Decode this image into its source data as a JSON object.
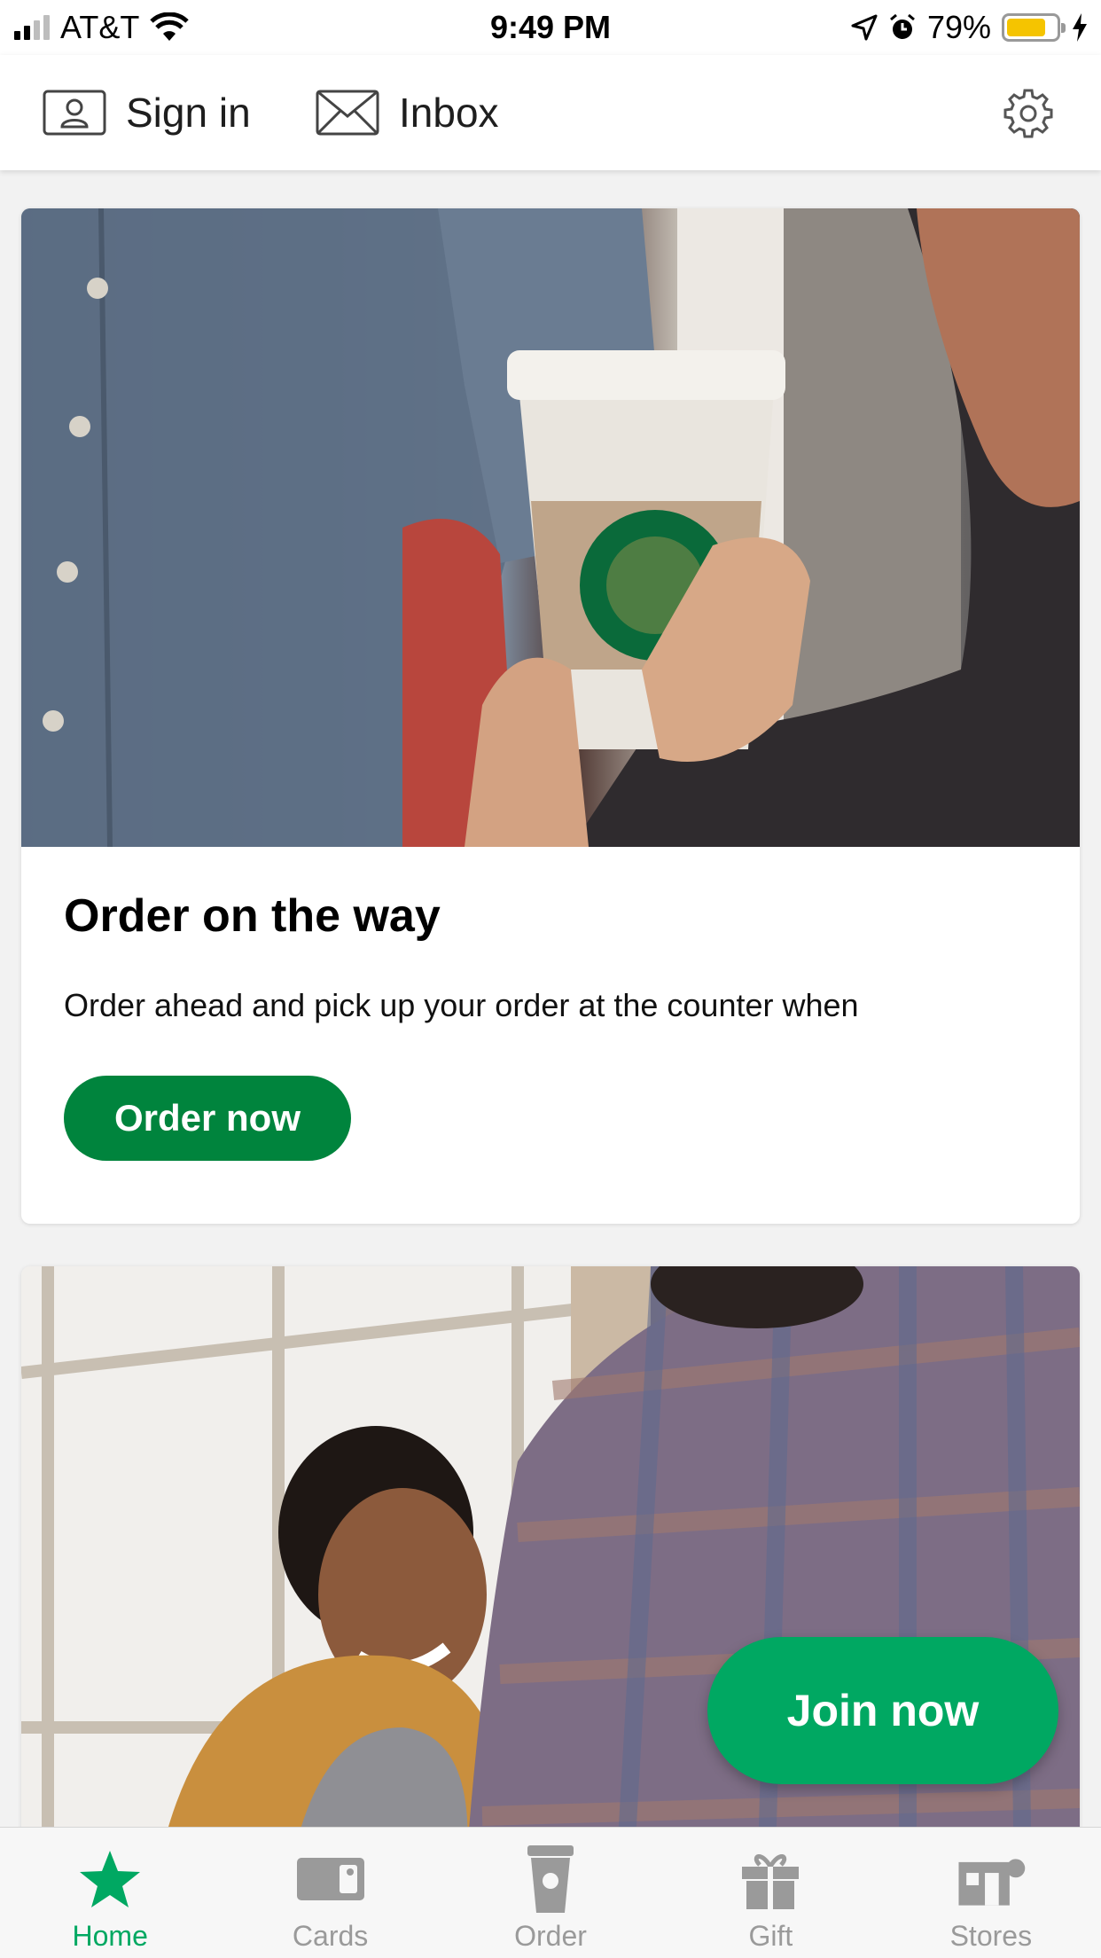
{
  "status_bar": {
    "carrier": "AT&T",
    "time": "9:49 PM",
    "battery_percent": "79%",
    "battery_level": 0.79
  },
  "top_nav": {
    "sign_in_label": "Sign in",
    "inbox_label": "Inbox"
  },
  "cards": [
    {
      "title": "Order on the way",
      "body": "Order ahead and pick up your order at the counter when",
      "button_label": "Order now"
    },
    {
      "button_label": "Join now"
    }
  ],
  "tab_bar": {
    "tabs": [
      {
        "label": "Home",
        "icon": "star-icon",
        "active": true
      },
      {
        "label": "Cards",
        "icon": "card-icon",
        "active": false
      },
      {
        "label": "Order",
        "icon": "cup-icon",
        "active": false
      },
      {
        "label": "Gift",
        "icon": "gift-icon",
        "active": false
      },
      {
        "label": "Stores",
        "icon": "store-icon",
        "active": false
      }
    ]
  },
  "colors": {
    "brand_green": "#00843d",
    "accent_green": "#00a862",
    "inactive_tab": "#9a9a9a"
  }
}
